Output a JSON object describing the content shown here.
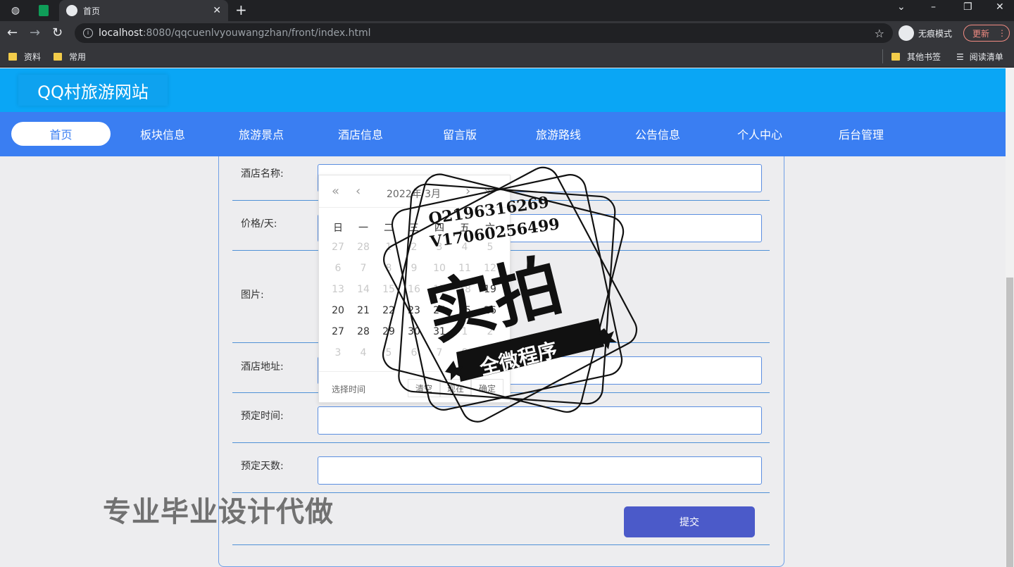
{
  "browser": {
    "tab_title": "首页",
    "url_host": "localhost",
    "url_path": ":8080/qqcuenlvyouwangzhan/front/index.html",
    "incognito_label": "无痕模式",
    "update_label": "更新",
    "bookmarks": [
      "资料",
      "常用"
    ],
    "bookmarks_right": [
      "其他书签",
      "阅读清单"
    ]
  },
  "site": {
    "title": "QQ村旅游网站",
    "nav": [
      "首页",
      "板块信息",
      "旅游景点",
      "酒店信息",
      "留言版",
      "旅游路线",
      "公告信息",
      "个人中心",
      "后台管理"
    ],
    "active_nav": "首页"
  },
  "form": {
    "fields": [
      {
        "label": "酒店名称:"
      },
      {
        "label": "价格/天:"
      },
      {
        "label": "图片:"
      },
      {
        "label": "酒店地址:"
      },
      {
        "label": "预定时间:"
      },
      {
        "label": "预定天数:"
      }
    ],
    "submit_label": "提交"
  },
  "datepicker": {
    "title": "2022年 3月",
    "weekdays": [
      "日",
      "一",
      "二",
      "三",
      "四",
      "五",
      "六"
    ],
    "weeks": [
      [
        "27",
        "28",
        "1",
        "2",
        "3",
        "4",
        "5"
      ],
      [
        "6",
        "7",
        "8",
        "9",
        "10",
        "11",
        "12"
      ],
      [
        "13",
        "14",
        "15",
        "16",
        "17",
        "18",
        "19"
      ],
      [
        "20",
        "21",
        "22",
        "23",
        "24",
        "25",
        "26"
      ],
      [
        "27",
        "28",
        "29",
        "30",
        "31",
        "1",
        "2"
      ],
      [
        "3",
        "4",
        "5",
        "6",
        "7",
        "8",
        "9"
      ]
    ],
    "footer_label": "选择时间",
    "clear_label": "清空",
    "now_label": "现在",
    "confirm_label": "确定"
  },
  "watermark": {
    "qq": "Q2196316269",
    "vx": "V17060256499",
    "big": "实拍",
    "ribbon": "全微程序",
    "bottom": "专业毕业设计代做"
  }
}
